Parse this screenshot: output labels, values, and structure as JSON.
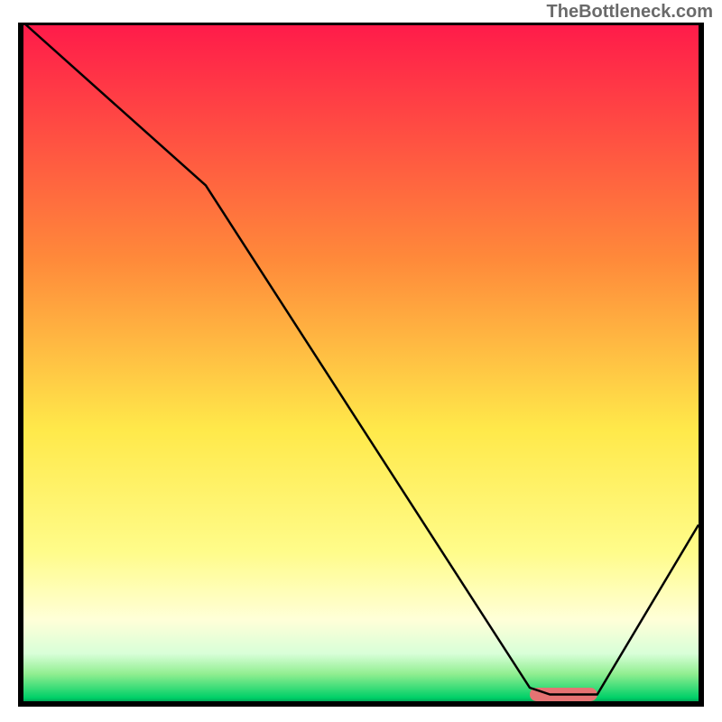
{
  "watermark": "TheBottleneck.com",
  "chart_data": {
    "type": "line",
    "title": "",
    "xlabel": "",
    "ylabel": "",
    "xlim": [
      0,
      100
    ],
    "ylim": [
      0,
      100
    ],
    "gradient_stops": [
      {
        "offset": 0,
        "color": "#ff1a4a"
      },
      {
        "offset": 35,
        "color": "#ff8a3a"
      },
      {
        "offset": 60,
        "color": "#ffe94a"
      },
      {
        "offset": 78,
        "color": "#fffc8a"
      },
      {
        "offset": 88,
        "color": "#ffffd8"
      },
      {
        "offset": 93,
        "color": "#d8ffd8"
      },
      {
        "offset": 96,
        "color": "#90ee90"
      },
      {
        "offset": 99.5,
        "color": "#00d068"
      },
      {
        "offset": 100,
        "color": "#00a858"
      }
    ],
    "series": [
      {
        "name": "bottleneck-curve",
        "color": "#000000",
        "x": [
          0,
          27,
          75,
          78,
          85,
          100
        ],
        "values": [
          100,
          76,
          2,
          1,
          1,
          26
        ]
      }
    ],
    "marker": {
      "name": "optimal-range",
      "color": "#e57373",
      "x_start": 75,
      "x_end": 85,
      "y": 1,
      "height": 2
    }
  }
}
